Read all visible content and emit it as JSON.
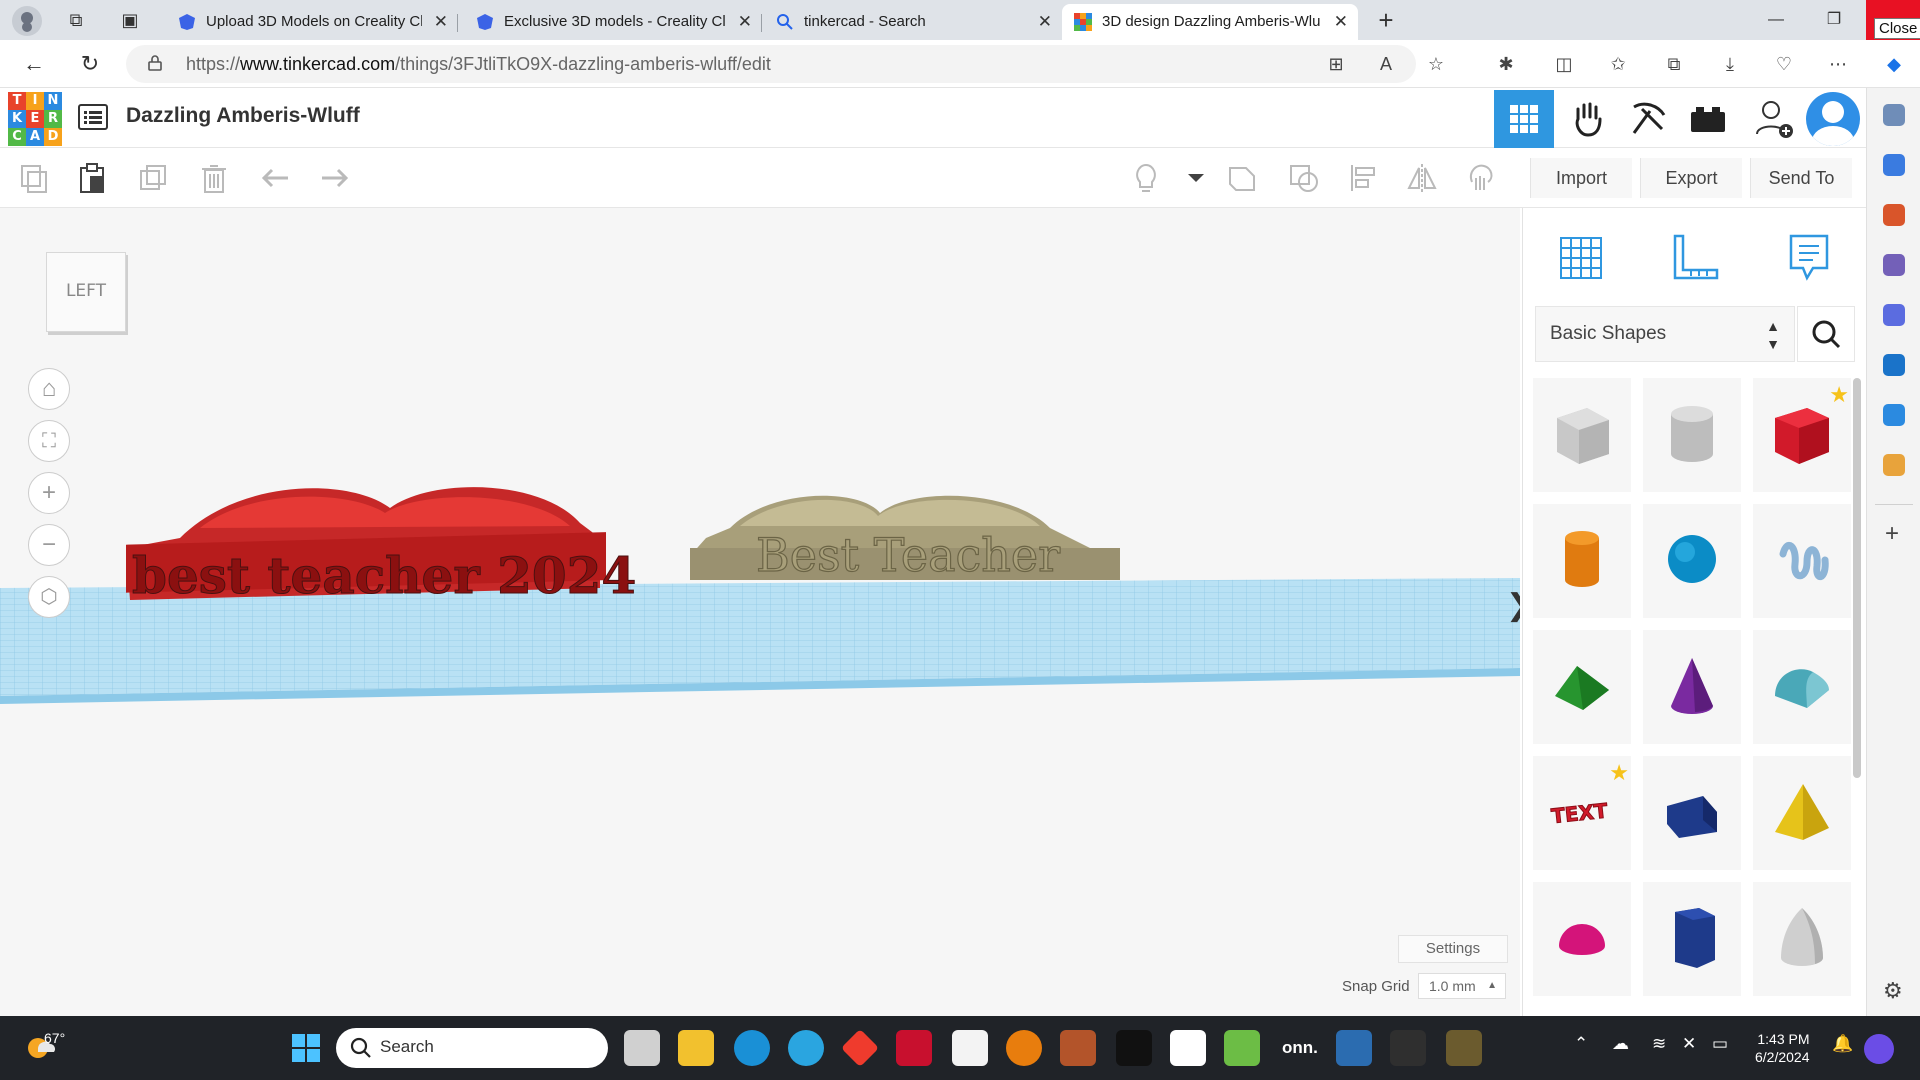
{
  "browser": {
    "tabs": [
      {
        "title": "Upload 3D Models on Creality Cl",
        "active": false
      },
      {
        "title": "Exclusive 3D models - Creality Cl",
        "active": false
      },
      {
        "title": "tinkercad - Search",
        "active": false
      },
      {
        "title": "3D design Dazzling Amberis-Wlu",
        "active": true
      }
    ],
    "new_tab": "+",
    "close_tooltip": "Close",
    "url_prefix": "https://",
    "url_host": "www.tinkercad.com",
    "url_path": "/things/3FJtliTkO9X-dazzling-amberis-wluff/edit"
  },
  "app": {
    "logo_letters": [
      "T",
      "I",
      "N",
      "K",
      "E",
      "R",
      "C",
      "A",
      "D"
    ],
    "logo_colors": [
      "#e8432b",
      "#f7a21b",
      "#2b8ae0",
      "#2b8ae0",
      "#e8432b",
      "#52b947",
      "#52b947",
      "#2b8ae0",
      "#f7a21b"
    ],
    "design_title": "Dazzling Amberis-Wluff"
  },
  "toolbar": {
    "import_label": "Import",
    "export_label": "Export",
    "send_to_label": "Send To"
  },
  "workplane": {
    "view_cube_label": "LEFT",
    "settings_label": "Settings",
    "snap_grid_label": "Snap Grid",
    "snap_grid_value": "1.0 mm",
    "model_left_text": "best teacher 2024",
    "model_right_text": "Best Teacher"
  },
  "panel": {
    "shape_library": "Basic Shapes",
    "shapes": [
      {
        "name": "box-hole",
        "starred": false
      },
      {
        "name": "cylinder-hole",
        "starred": false
      },
      {
        "name": "box",
        "starred": true
      },
      {
        "name": "cylinder",
        "starred": false
      },
      {
        "name": "sphere",
        "starred": false
      },
      {
        "name": "scribble",
        "starred": false
      },
      {
        "name": "roof",
        "starred": false
      },
      {
        "name": "cone",
        "starred": false
      },
      {
        "name": "round-roof",
        "starred": false
      },
      {
        "name": "text",
        "starred": true
      },
      {
        "name": "wedge",
        "starred": false
      },
      {
        "name": "pyramid",
        "starred": false
      },
      {
        "name": "half-sphere",
        "starred": false
      },
      {
        "name": "polygon",
        "starred": false
      },
      {
        "name": "paraboloid",
        "starred": false
      }
    ],
    "text_shape_label": "TEXT"
  },
  "taskbar": {
    "temperature": "67°",
    "search_label": "Search",
    "onn_label": "onn.",
    "time": "1:43 PM",
    "date": "6/2/2024"
  }
}
